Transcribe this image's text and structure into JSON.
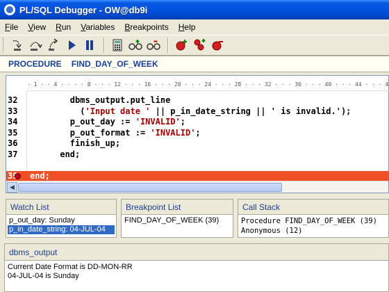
{
  "window": {
    "title": "PL/SQL Debugger - OW@db9i"
  },
  "menu": [
    {
      "pre": "",
      "mn": "F",
      "post": "ile"
    },
    {
      "pre": "",
      "mn": "V",
      "post": "iew"
    },
    {
      "pre": "",
      "mn": "R",
      "post": "un"
    },
    {
      "pre": "",
      "mn": "V",
      "post": "ariables"
    },
    {
      "pre": "",
      "mn": "B",
      "post": "reakpoints"
    },
    {
      "pre": "",
      "mn": "H",
      "post": "elp"
    }
  ],
  "toolbar": {
    "icons": [
      "step-into-icon",
      "step-over-icon",
      "step-out-icon",
      "run-icon",
      "pause-icon",
      "calculator-icon",
      "watch-icon",
      "watch-remove-icon",
      "breakpoint-toggle-icon",
      "breakpoint-add-icon",
      "breakpoint-remove-icon"
    ]
  },
  "procedure": {
    "keyword": "PROCEDURE",
    "name": "FIND_DAY_OF_WEEK"
  },
  "ruler": {
    "text": "· 1 · · 4 · · · · 8 · · · 12 · · · 16 · · · 20 · · · 24 · · · 28 · · · 32 · · · 36 · · · 40 · · · 44 · · · 48 · · · 52 · · · 56 · · · 60 · · · 64 ·"
  },
  "code": [
    {
      "num": "32",
      "pre": "        dbms_output.put_line",
      "str": "",
      "post": ""
    },
    {
      "num": "33",
      "pre": "          (",
      "str": "'Input date '",
      "post": " || p_in_date_string || ' is invalid.');"
    },
    {
      "num": "34",
      "pre": "        p_out_day := ",
      "str": "'INVALID'",
      "post": ";"
    },
    {
      "num": "35",
      "pre": "        p_out_format := ",
      "str": "'INVALID'",
      "post": ";"
    },
    {
      "num": "36",
      "pre": "        finish_up;",
      "str": "",
      "post": ""
    },
    {
      "num": "37",
      "pre": "      end;",
      "str": "",
      "post": ""
    },
    {
      "num": "",
      "pre": "",
      "str": "",
      "post": ""
    },
    {
      "num": "39",
      "pre": "end;",
      "str": "",
      "post": ""
    }
  ],
  "current_line": "39",
  "panels": {
    "watch": {
      "title": "Watch List",
      "rows": [
        "p_out_day: Sunday",
        "p_in_date_string: 04-JUL-04"
      ],
      "selected": 1
    },
    "breakpoints": {
      "title": "Breakpoint List",
      "rows": [
        "FIND_DAY_OF_WEEK (39)"
      ]
    },
    "callstack": {
      "title": "Call Stack",
      "rows": [
        "Procedure FIND_DAY_OF_WEEK (39)",
        "Anonymous  (12)"
      ]
    }
  },
  "output": {
    "title": "dbms_output",
    "lines": [
      "Current Date Format is DD-MON-RR",
      "04-JUL-04 is Sunday"
    ]
  }
}
